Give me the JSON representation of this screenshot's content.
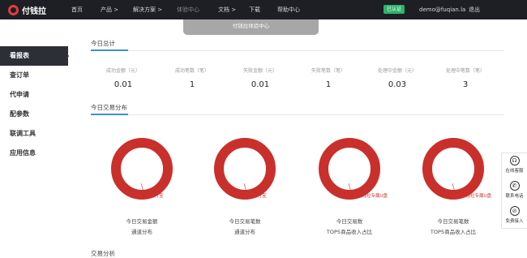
{
  "brand": {
    "name": "付钱拉",
    "accent": "#e23b3b"
  },
  "nav": {
    "items": [
      "首页",
      "产品 >",
      "解决方案 >",
      "体验中心",
      "文档 >",
      "下载",
      "帮助中心"
    ],
    "verified": "已认证",
    "user": "demo@fuqian.la",
    "logout": "退出"
  },
  "dropdown": {
    "label": "付钱拉体验中心"
  },
  "sidebar": {
    "items": [
      "看报表",
      "查订单",
      "代申请",
      "配参数",
      "联调工具",
      "应用信息"
    ],
    "active_index": 0
  },
  "summary": {
    "title": "今日总计",
    "stats": [
      {
        "label": "成功金额（元）",
        "value": "0.01"
      },
      {
        "label": "成功笔数（笔）",
        "value": "1"
      },
      {
        "label": "失败金额（元）",
        "value": "0.01"
      },
      {
        "label": "失败笔数（笔）",
        "value": "1"
      },
      {
        "label": "处理中金额（元）",
        "value": "0.03"
      },
      {
        "label": "处理中笔数（笔）",
        "value": "3"
      }
    ]
  },
  "distribution": {
    "title": "今日交易分布",
    "charts": [
      {
        "slice_label": "支付宝",
        "caption1": "今日交易金额",
        "caption2": "通道分布",
        "color": "#c9302c"
      },
      {
        "slice_label": "支付宝",
        "caption1": "今日交易笔数",
        "caption2": "通道分布",
        "color": "#c9302c"
      },
      {
        "slice_label": "付钱拉专属U盘",
        "caption1": "今日交易数",
        "caption2": "TOP5商品收入占比",
        "color": "#c9302c"
      },
      {
        "slice_label": "付钱拉专属U盘",
        "caption1": "今日交易笔数",
        "caption2": "TOP5商品收入占比",
        "color": "#c9302c"
      }
    ]
  },
  "analysis": {
    "title": "交易分析"
  },
  "tools": [
    {
      "label": "在线客服",
      "icon": "headset-icon"
    },
    {
      "label": "联系电话",
      "icon": "phone-icon"
    },
    {
      "label": "免费接入",
      "icon": "link-icon"
    }
  ]
}
